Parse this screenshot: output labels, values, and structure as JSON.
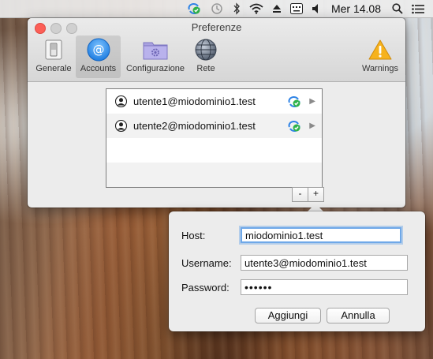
{
  "menubar": {
    "icons": [
      "sync-status-icon",
      "time-machine-icon",
      "bluetooth-icon",
      "wifi-icon",
      "eject-icon",
      "keyboard-input-icon",
      "volume-icon",
      "spotlight-search-icon",
      "notification-center-icon"
    ],
    "clock": "Mer 14.08"
  },
  "window": {
    "title": "Preferenze",
    "toolbar": [
      {
        "label": "Generale",
        "icon": "switch-icon"
      },
      {
        "label": "Accounts",
        "icon": "at-sign-icon",
        "selected": true
      },
      {
        "label": "Configurazione",
        "icon": "folder-gear-icon"
      },
      {
        "label": "Rete",
        "icon": "globe-network-icon"
      },
      {
        "label": "Warnings",
        "icon": "warning-triangle-icon"
      }
    ],
    "accounts": [
      {
        "email": "utente1@miodominio1.test",
        "status_icon": "sync-ok-icon"
      },
      {
        "email": "utente2@miodominio1.test",
        "status_icon": "sync-ok-icon"
      }
    ],
    "remove_label": "-",
    "add_label": "+"
  },
  "popover": {
    "host_label": "Host:",
    "host_value": "miodominio1.test",
    "username_label": "Username:",
    "username_value": "utente3@miodominio1.test",
    "password_label": "Password:",
    "password_value": "••••••",
    "add_label": "Aggiungi",
    "cancel_label": "Annulla"
  },
  "colors": {
    "accent": "#2f83e6",
    "focus_ring": "#6fa8e8",
    "status_green": "#2fb34a",
    "close": "#fc5f57"
  }
}
